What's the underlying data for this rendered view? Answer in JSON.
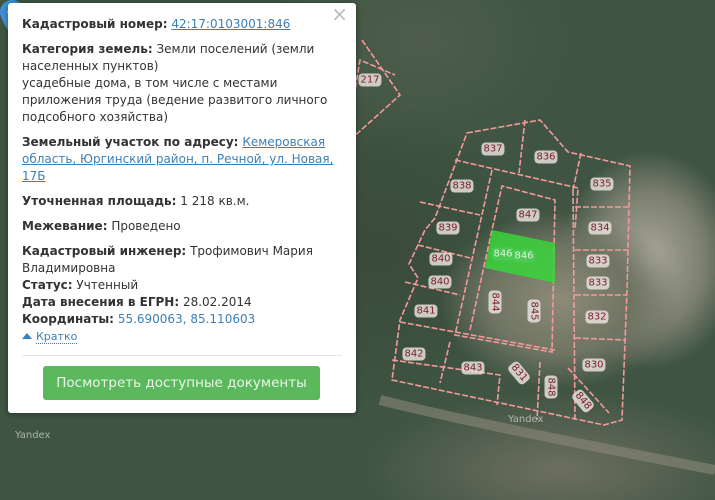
{
  "popup": {
    "cadastral_label": "Кадастровый номер:",
    "cadastral_value": "42:17:0103001:846",
    "category_label": "Категория земель:",
    "category_value": "Земли поселений (земли населенных пунктов)",
    "category_use": "усадебные дома, в том числе с местами приложения труда (ведение развитого личного подсобного хозяйства)",
    "address_label": "Земельный участок по адресу:",
    "address_value": "Кемеровская область, Юргинский район, п. Речной, ул. Новая, 17Б",
    "area_label": "Уточненная площадь:",
    "area_value": "1 218 кв.м.",
    "survey_label": "Межевание:",
    "survey_value": "Проведено",
    "engineer_label": "Кадастровый инженер:",
    "engineer_value": "Трофимович Мария Владимировна",
    "status_label": "Статус:",
    "status_value": "Учтенный",
    "date_label": "Дата внесения в ЕГРН:",
    "date_value": "28.02.2014",
    "coords_label": "Координаты:",
    "coords_value": "55.690063, 85.110603",
    "brief_link": "Кратко",
    "docs_button": "Посмотреть доступные документы",
    "close_icon": "×"
  },
  "map": {
    "parcels": [
      "217",
      "837",
      "836",
      "835",
      "838",
      "847",
      "834",
      "839",
      "846",
      "846",
      "840",
      "833",
      "840",
      "833",
      "844",
      "845",
      "841",
      "832",
      "842",
      "830",
      "843",
      "831",
      "848",
      "848"
    ],
    "watermark": "Yandex",
    "selected_color": "#3ad43a",
    "boundary_color": "#f08080"
  }
}
